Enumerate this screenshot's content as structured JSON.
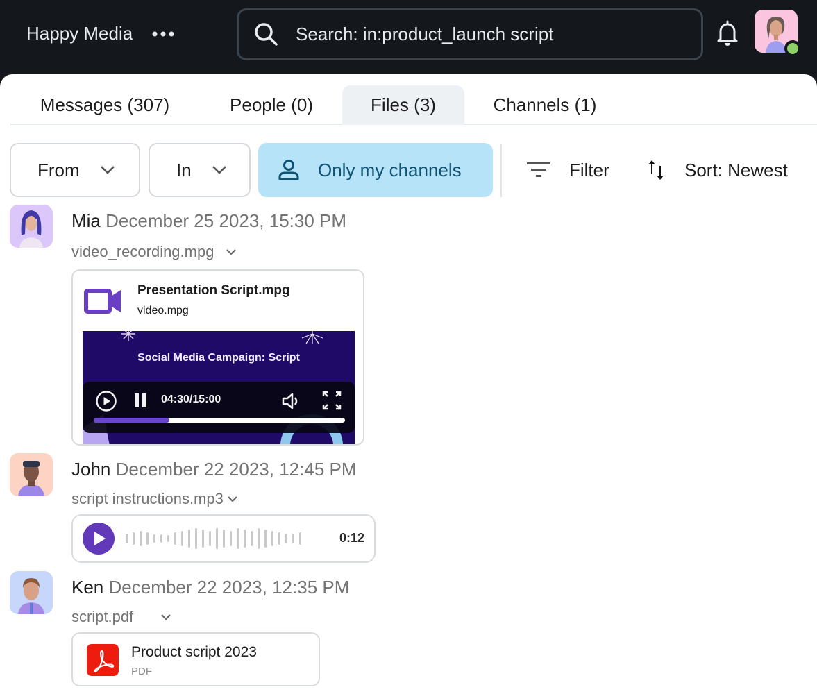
{
  "header": {
    "workspace": "Happy Media",
    "more_icon": "more-horizontal-icon",
    "search_value": "Search: in:product_launch script",
    "search_icon": "search-icon",
    "bell_icon": "bell-icon",
    "presence_status": "online",
    "presence_color": "#8ed16b"
  },
  "tabs": [
    {
      "label": "Messages (307)",
      "active": false
    },
    {
      "label": "People (0)",
      "active": false
    },
    {
      "label": "Files (3)",
      "active": true
    },
    {
      "label": "Channels (1)",
      "active": false
    }
  ],
  "filters": {
    "from_label": "From",
    "in_label": "In",
    "only_mine_label": "Only my channels",
    "filter_label": "Filter",
    "sort_label": "Sort: Newest"
  },
  "results": [
    {
      "author": "Mia",
      "date": "December 25 2023, 15:30 PM",
      "file_name": "video_recording.mpg",
      "attachment": {
        "type": "video",
        "title": "Presentation Script.mpg",
        "subtitle": "video.mpg",
        "thumbnail_text": "Social Media Campaign: Script",
        "time": "04:30/15:00",
        "progress_fraction": 0.3
      }
    },
    {
      "author": "John",
      "date": "December 22 2023, 12:45 PM",
      "file_name": "script instructions.mp3",
      "attachment": {
        "type": "audio",
        "duration": "0:12"
      }
    },
    {
      "author": "Ken",
      "date": "December 22 2023, 12:35 PM",
      "file_name": "script.pdf",
      "attachment": {
        "type": "pdf",
        "title": "Product script 2023",
        "kind": "PDF"
      }
    }
  ],
  "colors": {
    "accent_purple": "#6239b8",
    "chip_active_bg": "#b6e3f8",
    "pdf_red": "#ee1c0e"
  }
}
